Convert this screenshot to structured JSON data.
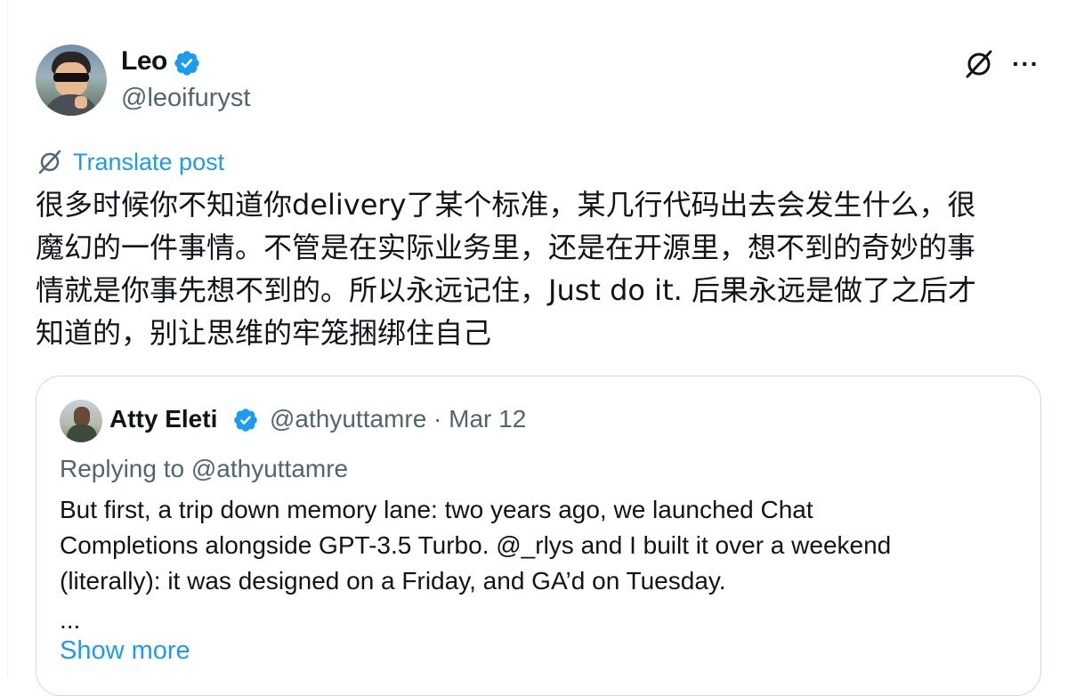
{
  "post": {
    "author_name": "Leo",
    "author_handle": "@leoifuryst",
    "translate_label": "Translate post",
    "text": "很多时候你不知道你delivery了某个标准，某几行代码出去会发生什么，很\n魔幻的一件事情。不管是在实际业务里，还是在开源里，想不到的奇妙的事\n情就是你事先想不到的。所以永远记住，Just do it. 后果永远是做了之后才\n知道的，别让思维的牢笼捆绑住自己",
    "more_label": "···"
  },
  "quote": {
    "author_name": "Atty Eleti",
    "meta": "@athyuttamre · Mar 12",
    "replying_to": "Replying to @athyuttamre",
    "text": "But first, a trip down memory lane: two years ago, we launched Chat\nCompletions alongside GPT-3.5 Turbo. @_rlys and I built it over a weekend\n(literally): it was designed on a Friday, and GA’d on Tuesday.",
    "ellipsis": "...",
    "show_more": "Show more"
  },
  "colors": {
    "accent": "#1d9bf0",
    "secondary_text": "#536471",
    "primary_text": "#0f1419",
    "border": "#cfd9de"
  },
  "icons": {
    "verified": "verified-badge-icon",
    "grok": "grok-icon",
    "translate": "translate-icon",
    "more": "more-icon"
  }
}
